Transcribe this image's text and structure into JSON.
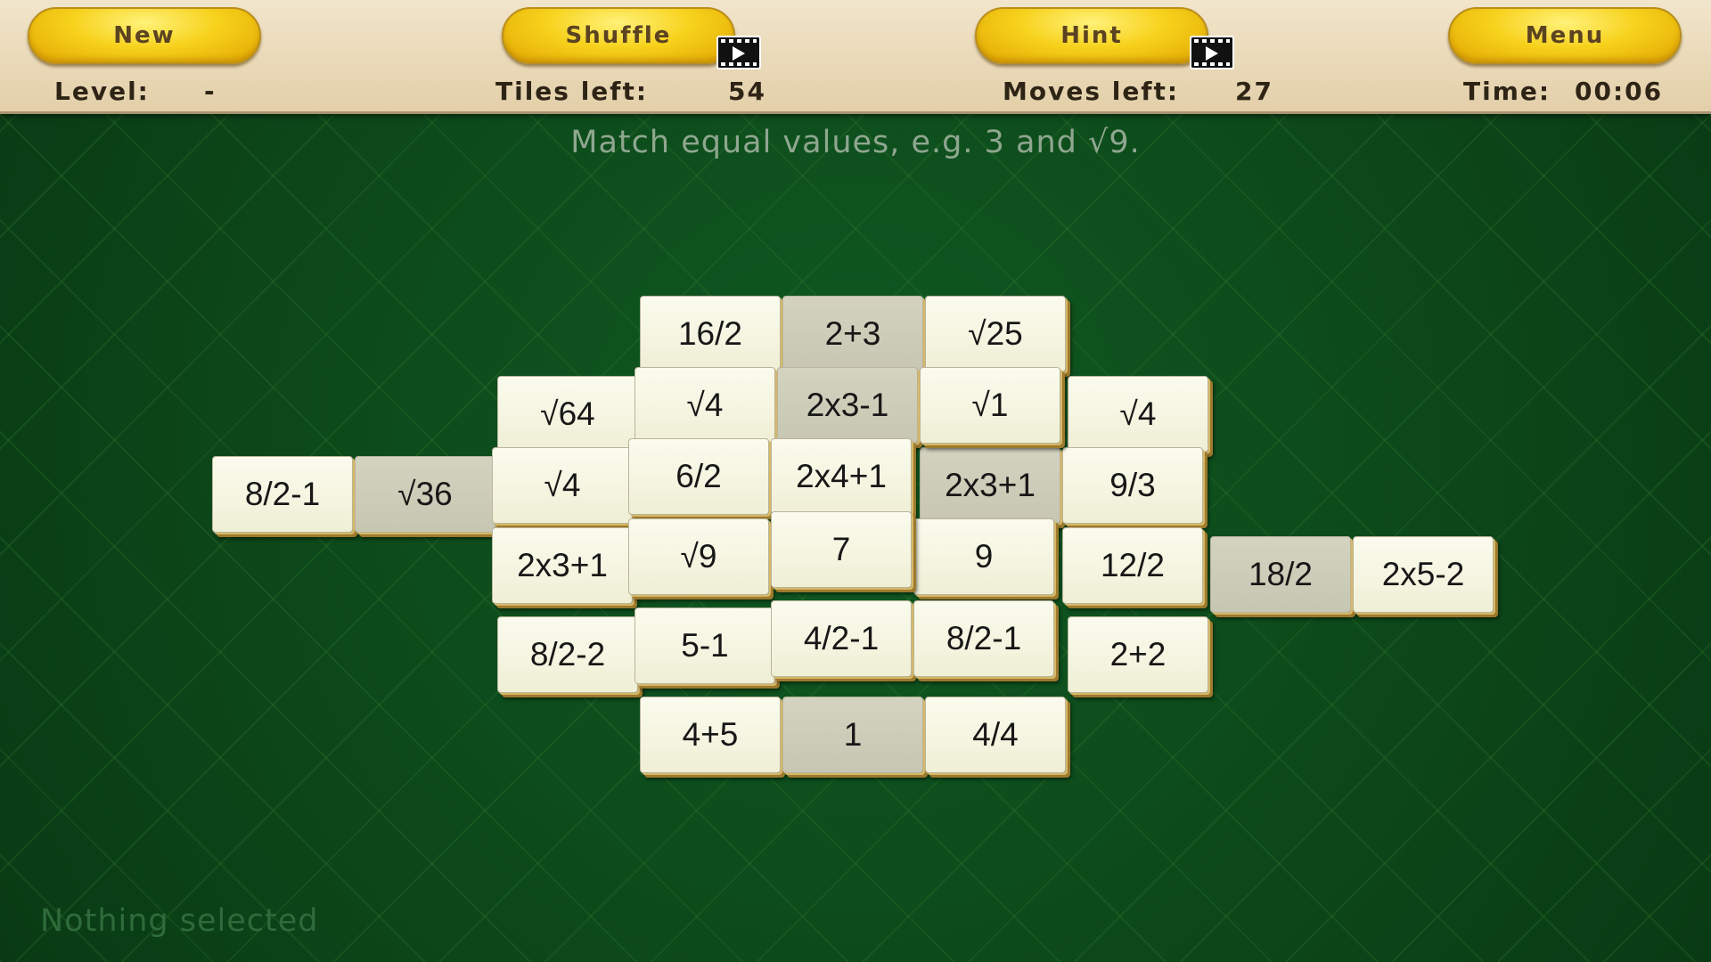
{
  "toolbar": {
    "new_label": "New",
    "shuffle_label": "Shuffle",
    "hint_label": "Hint",
    "menu_label": "Menu",
    "shuffle_video_icon": "video-ad-icon",
    "hint_video_icon": "video-ad-icon"
  },
  "stats": {
    "level_label": "Level:",
    "level_value": "-",
    "tiles_label": "Tiles left:",
    "tiles_value": "54",
    "moves_label": "Moves left:",
    "moves_value": "27",
    "time_label": "Time:",
    "time_value": "00:06"
  },
  "instruction": "Match equal values, e.g. 3 and √9.",
  "status": "Nothing selected",
  "colors": {
    "board_green": "#0c4418",
    "tile_face": "#f5f5e2",
    "tile_blocked": "#cdcdb9",
    "button_yellow": "#f7d21c"
  },
  "tiles": [
    {
      "label": "16/2",
      "blocked": false
    },
    {
      "label": "2+3",
      "blocked": true
    },
    {
      "label": "√25",
      "blocked": false
    },
    {
      "label": "√64",
      "blocked": false
    },
    {
      "label": "√4",
      "blocked": false
    },
    {
      "label": "2x3-1",
      "blocked": true
    },
    {
      "label": "√1",
      "blocked": false
    },
    {
      "label": "√4",
      "blocked": false
    },
    {
      "label": "8/2-1",
      "blocked": false
    },
    {
      "label": "√36",
      "blocked": true
    },
    {
      "label": "√4",
      "blocked": false
    },
    {
      "label": "6/2",
      "blocked": false
    },
    {
      "label": "2x4+1",
      "blocked": false
    },
    {
      "label": "2x3+1",
      "blocked": true
    },
    {
      "label": "9/3",
      "blocked": false
    },
    {
      "label": "2x3+1",
      "blocked": false
    },
    {
      "label": "√9",
      "blocked": false
    },
    {
      "label": "7",
      "blocked": false
    },
    {
      "label": "9",
      "blocked": false
    },
    {
      "label": "12/2",
      "blocked": false
    },
    {
      "label": "18/2",
      "blocked": true
    },
    {
      "label": "2x5-2",
      "blocked": false
    },
    {
      "label": "8/2-2",
      "blocked": false
    },
    {
      "label": "5-1",
      "blocked": false
    },
    {
      "label": "4/2-1",
      "blocked": false
    },
    {
      "label": "8/2-1",
      "blocked": false
    },
    {
      "label": "2+2",
      "blocked": false
    },
    {
      "label": "4+5",
      "blocked": false
    },
    {
      "label": "1",
      "blocked": true
    },
    {
      "label": "4/4",
      "blocked": false
    }
  ]
}
